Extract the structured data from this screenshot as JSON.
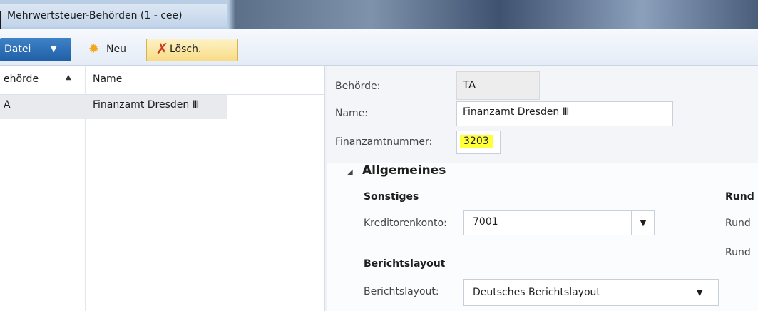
{
  "window": {
    "title": "Mehrwertsteuer-Behörden (1 - cee)"
  },
  "toolbar": {
    "file_menu_label": "Datei",
    "new_label": "Neu",
    "delete_label": "Lösch."
  },
  "list": {
    "columns": [
      "ehörde",
      "Name"
    ],
    "rows": [
      {
        "behoerde": "A",
        "name": "Finanzamt Dresden Ⅲ"
      }
    ]
  },
  "details": {
    "behoerde_label": "Behörde:",
    "behoerde_value": "TA",
    "name_label": "Name:",
    "name_value": "Finanzamt Dresden Ⅲ",
    "finanzamtnummer_label": "Finanzamtnummer:",
    "finanzamtnummer_value": "3203"
  },
  "section": {
    "title": "Allgemeines",
    "sonstiges": {
      "group_title": "Sonstiges",
      "kreditorenkonto_label": "Kreditorenkonto:",
      "kreditorenkonto_value": "7001"
    },
    "berichtslayout": {
      "group_title": "Berichtslayout",
      "label": "Berichtslayout:",
      "value": "Deutsches Berichtslayout"
    },
    "rund": {
      "group_title": "Rund",
      "label1": "Rund",
      "label2": "Rund"
    }
  },
  "colors": {
    "file_button": "#1f5fa6",
    "highlight": "#ffff3a",
    "selected_row": "#e8eaed"
  },
  "icons": {
    "new": "sun-icon",
    "delete": "x-icon"
  }
}
